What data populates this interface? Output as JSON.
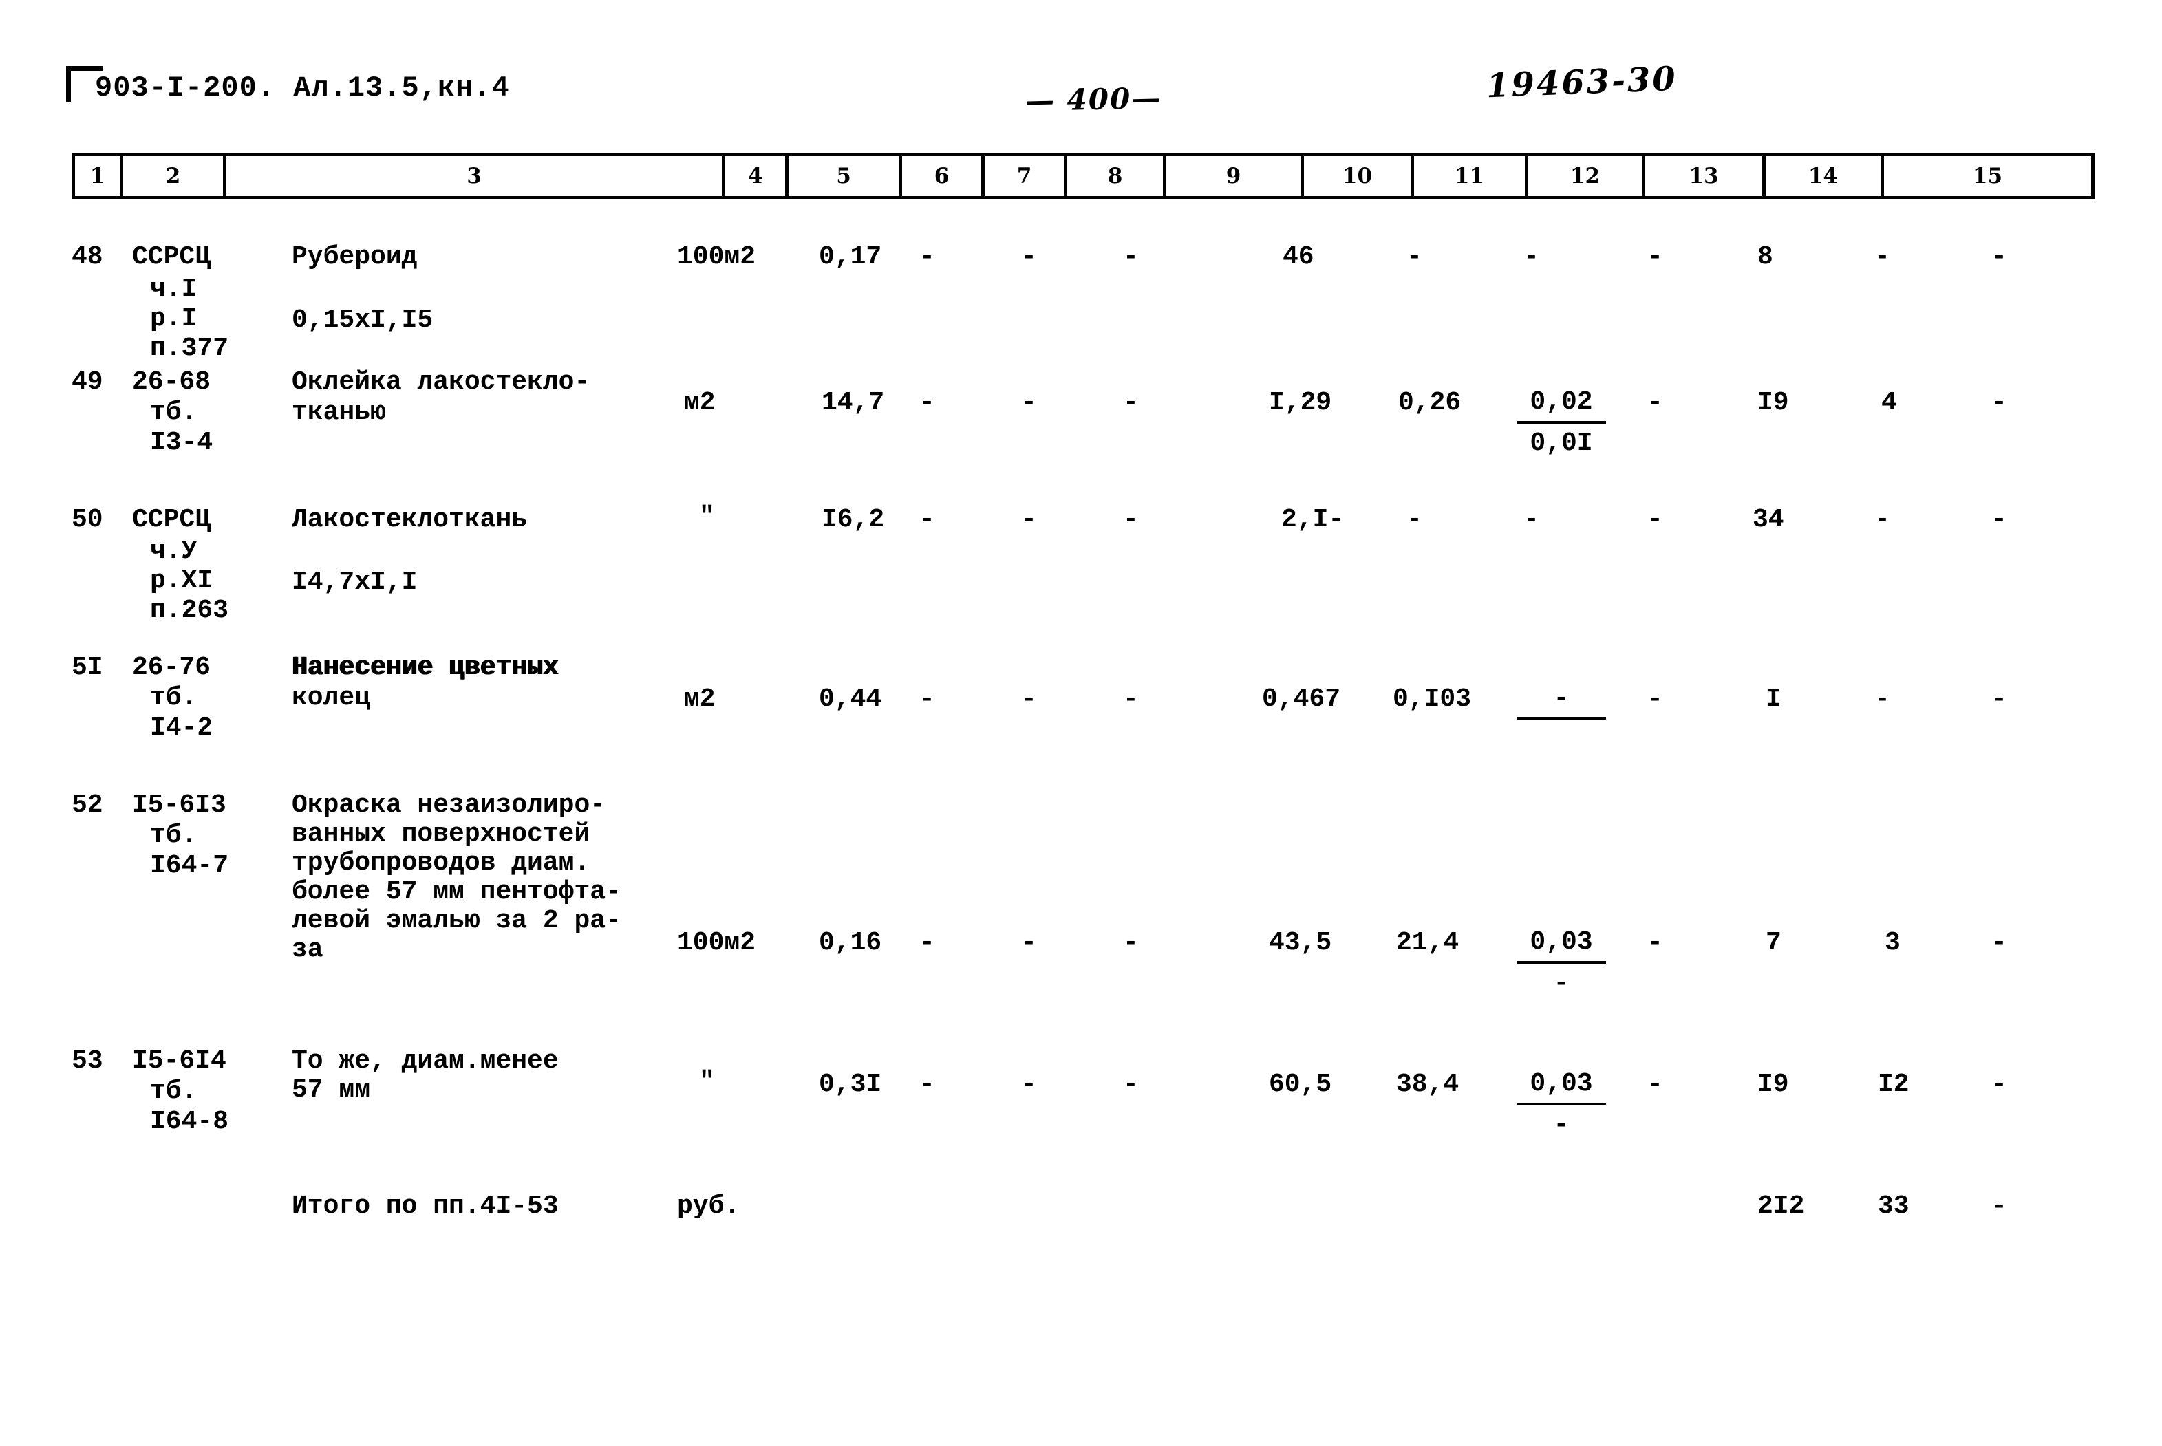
{
  "header": {
    "doc_code": "903-I-200. Ал.13.5,кн.4",
    "page_number": "— 400—",
    "stamp_number": "19463-30"
  },
  "table": {
    "column_numbers": [
      "1",
      "2",
      "3",
      "4",
      "5",
      "6",
      "7",
      "8",
      "9",
      "10",
      "11",
      "12",
      "13",
      "14",
      "15"
    ],
    "rows": [
      {
        "no": "48",
        "code_lines": [
          "ССРСЦ",
          "ч.I",
          "р.I",
          "п.377"
        ],
        "desc_lines": [
          "Рубероид",
          "",
          "0,15xI,I5"
        ],
        "unit": "100м2",
        "c5": "0,17",
        "c6": "-",
        "c7": "-",
        "c8": "-",
        "c9": "46",
        "c10": "-",
        "c11": "-",
        "c12": "-",
        "c13": "8",
        "c14": "-",
        "c15": "-"
      },
      {
        "no": "49",
        "code_lines": [
          "26-68",
          "тб.",
          "I3-4"
        ],
        "desc_lines": [
          "Оклейка лакостекло-",
          "тканью"
        ],
        "unit": "м2",
        "c5": "14,7",
        "c6": "-",
        "c7": "-",
        "c8": "-",
        "c9": "I,29",
        "c10": "0,26",
        "c11_top": "0,02",
        "c11_bot": "0,0I",
        "c12": "-",
        "c13": "I9",
        "c14": "4",
        "c15": "-"
      },
      {
        "no": "50",
        "code_lines": [
          "ССРСЦ",
          "ч.У",
          "р.XI",
          "п.263"
        ],
        "desc_lines": [
          "Лакостеклоткань",
          "",
          "I4,7xI,I"
        ],
        "unit": "\"",
        "c5": "I6,2",
        "c6": "-",
        "c7": "-",
        "c8": "-",
        "c9": "2,I-",
        "c10": "-",
        "c11": "-",
        "c12": "-",
        "c13": "34",
        "c14": "-",
        "c15": "-"
      },
      {
        "no": "5I",
        "code_lines": [
          "26-76",
          "тб.",
          "I4-2"
        ],
        "desc_lines": [
          "Нанесение цветных",
          "колец"
        ],
        "unit": "м2",
        "c5": "0,44",
        "c6": "-",
        "c7": "-",
        "c8": "-",
        "c9": "0,467",
        "c10": "0,I03",
        "c11_top": "-",
        "c11_bot": "",
        "c12": "-",
        "c13": "I",
        "c14": "-",
        "c15": "-"
      },
      {
        "no": "52",
        "code_lines": [
          "I5-6I3",
          "тб.",
          "I64-7"
        ],
        "desc_lines": [
          "Окраска незаизолиро-",
          "ванных поверхностей",
          "трубопроводов диам.",
          "более 57 мм пентофта-",
          "левой эмалью за 2 ра-",
          "за"
        ],
        "unit": "100м2",
        "c5": "0,16",
        "c6": "-",
        "c7": "-",
        "c8": "-",
        "c9": "43,5",
        "c10": "21,4",
        "c11_top": "0,03",
        "c11_bot": "-",
        "c12": "-",
        "c13": "7",
        "c14": "3",
        "c15": "-"
      },
      {
        "no": "53",
        "code_lines": [
          "I5-6I4",
          "тб.",
          "I64-8"
        ],
        "desc_lines": [
          "То же, диам.менее",
          "57 мм"
        ],
        "unit": "\"",
        "c5": "0,3I",
        "c6": "-",
        "c7": "-",
        "c8": "-",
        "c9": "60,5",
        "c10": "38,4",
        "c11_top": "0,03",
        "c11_bot": "-",
        "c12": "-",
        "c13": "I9",
        "c14": "I2",
        "c15": "-"
      }
    ],
    "total_row": {
      "label": "Итого по пп.4I-53",
      "unit": "руб.",
      "c13": "2I2",
      "c14": "33",
      "c15": "-"
    }
  }
}
